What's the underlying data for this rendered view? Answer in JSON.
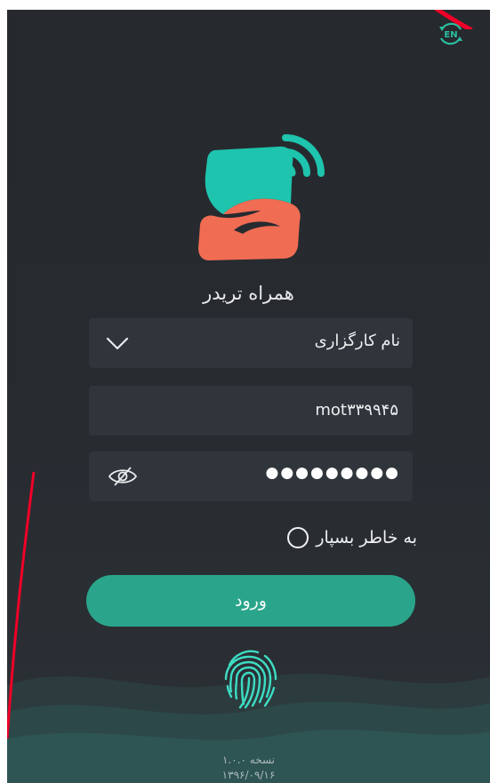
{
  "app": {
    "title": "همراه تریدر"
  },
  "lang_button": {
    "label": "EN"
  },
  "form": {
    "broker": {
      "placeholder": "نام کارگزاری"
    },
    "username": {
      "value": "mot۳۳۹۹۴۵"
    },
    "password": {
      "mask": "●●●●●●●●●"
    },
    "remember": {
      "label": "به خاطر بسپار",
      "checked": false
    },
    "login_label": "ورود"
  },
  "version": {
    "line1": "نسخه ۱.۰.۰",
    "line2": "۱۳۹۶/۰۹/۱۶"
  },
  "colors": {
    "background": "#272b30",
    "field": "#30353b",
    "accent_teal": "#2aa58b",
    "logo_teal": "#1ec4ad",
    "logo_coral": "#f06c53",
    "annotation_red": "#f00028"
  }
}
